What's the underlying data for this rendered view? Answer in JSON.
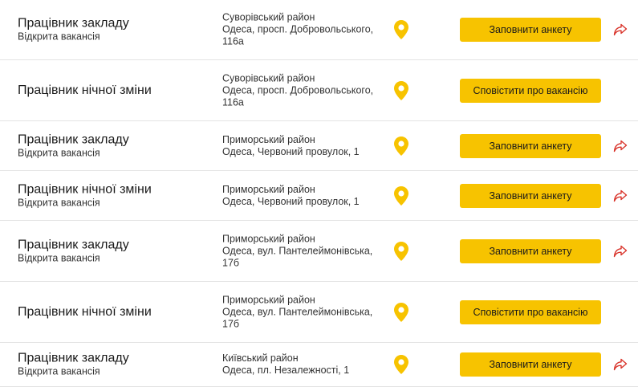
{
  "colors": {
    "accent": "#f7c300",
    "share_icon": "#d9342b",
    "divider": "#e3e3e3"
  },
  "icons": {
    "location": "map-pin-icon",
    "share": "share-arrow-icon"
  },
  "vacancies": [
    {
      "title": "Працівник закладу",
      "status": "Відкрита вакансія",
      "address_lines": [
        "Суворівський район",
        "Одеса, просп. Добровольського,",
        "116а"
      ],
      "button": "Заповнити анкету",
      "share": true
    },
    {
      "title": "Працівник нічної зміни",
      "status": "",
      "address_lines": [
        "Суворівський район",
        "Одеса, просп. Добровольського,",
        "116а"
      ],
      "button": "Сповістити про вакансію",
      "share": false
    },
    {
      "title": "Працівник закладу",
      "status": "Відкрита вакансія",
      "address_lines": [
        "Приморський район",
        "Одеса, Червоний провулок, 1"
      ],
      "button": "Заповнити анкету",
      "share": true
    },
    {
      "title": "Працівник нічної зміни",
      "status": "Відкрита вакансія",
      "address_lines": [
        "Приморський район",
        "Одеса, Червоний провулок, 1"
      ],
      "button": "Заповнити анкету",
      "share": true
    },
    {
      "title": "Працівник закладу",
      "status": "Відкрита вакансія",
      "address_lines": [
        "Приморський район",
        "Одеса, вул. Пантелеймонівська,",
        "17б"
      ],
      "button": "Заповнити анкету",
      "share": true
    },
    {
      "title": "Працівник нічної зміни",
      "status": "",
      "address_lines": [
        "Приморський район",
        "Одеса, вул. Пантелеймонівська,",
        "17б"
      ],
      "button": "Сповістити про вакансію",
      "share": false
    },
    {
      "title": "Працівник закладу",
      "status": "Відкрита вакансія",
      "address_lines": [
        "Київський район",
        "Одеса, пл. Незалежності, 1"
      ],
      "button": "Заповнити анкету",
      "share": true
    }
  ]
}
